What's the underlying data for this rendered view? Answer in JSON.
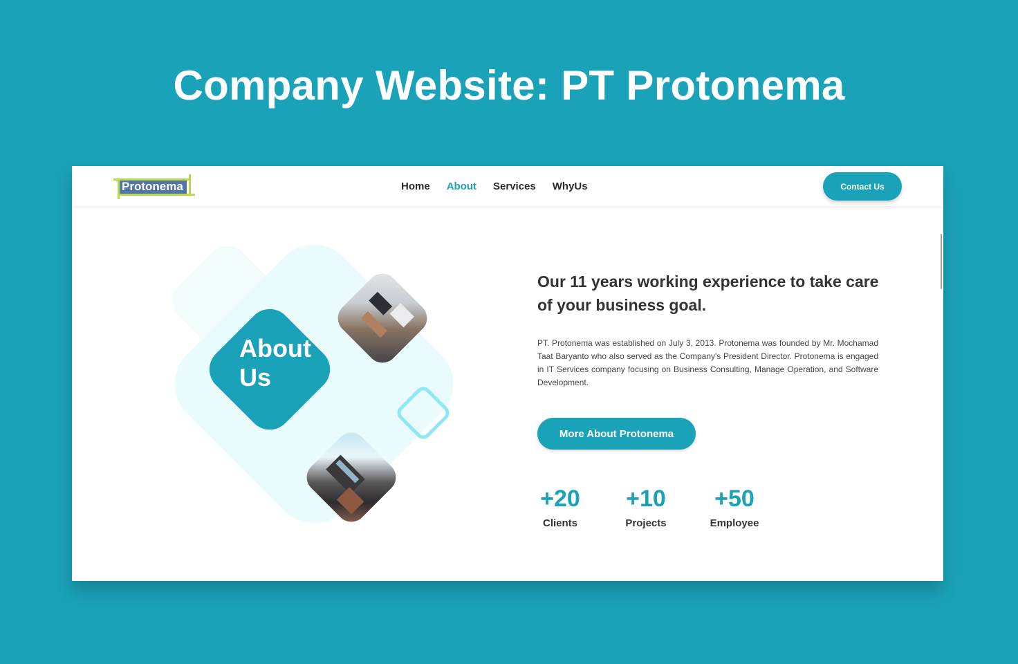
{
  "page": {
    "title": "Company Website: PT Protonema"
  },
  "colors": {
    "background": "#1aa2b8",
    "accent": "#1aa2b8",
    "logo_blue": "#5574a6",
    "logo_green": "#b7d94c",
    "text_dark": "#333333"
  },
  "navbar": {
    "logo_text": "Protonema",
    "links": [
      {
        "label": "Home",
        "active": false
      },
      {
        "label": "About",
        "active": true
      },
      {
        "label": "Services",
        "active": false
      },
      {
        "label": "WhyUs",
        "active": false
      }
    ],
    "contact_button": "Contact Us"
  },
  "hero": {
    "about_label": "About Us",
    "heading": "Our 11 years working experience to take care of your business goal.",
    "description": "PT. Protonema was established on July 3, 2013. Protonema was founded by Mr. Mochamad Taat Baryanto who also served as the Company's President Director. Protonema is engaged in IT Services company focusing on Business Consulting, Manage Operation, and Software Development.",
    "button": "More About Protonema"
  },
  "stats": [
    {
      "value": "+20",
      "label": "Clients"
    },
    {
      "value": "+10",
      "label": "Projects"
    },
    {
      "value": "+50",
      "label": "Employee"
    }
  ],
  "images": {
    "office_photo": "office-photo",
    "building_photo": "building-photo"
  }
}
